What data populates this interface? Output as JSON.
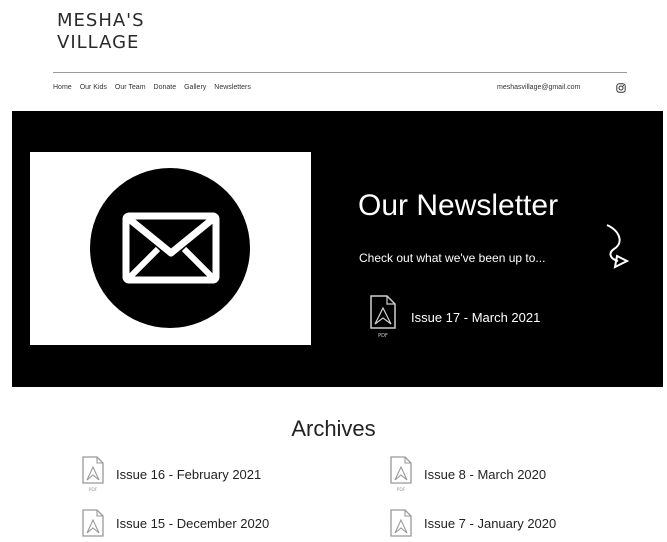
{
  "logo": {
    "line1": "MESHA'S",
    "line2": "VILLAGE"
  },
  "nav": {
    "items": [
      "Home",
      "Our Kids",
      "Our Team",
      "Donate",
      "Gallery",
      "Newsletters"
    ]
  },
  "header": {
    "email": "meshasvillage@gmail.com",
    "social_icon": "instagram-icon"
  },
  "hero": {
    "title": "Our Newsletter",
    "subtitle": "Check out what we've been up to...",
    "latest_issue": "Issue 17 - March 2021",
    "file_label": "PDF"
  },
  "archives": {
    "heading": "Archives",
    "items": [
      "Issue 16 - February 2021",
      "Issue 8 - March 2020",
      "Issue 15 - December 2020",
      "Issue 7 - January 2020"
    ],
    "file_label": "PDF"
  },
  "colors": {
    "hero_bg": "#000000",
    "text": "#222222",
    "divider": "#9a9a9a"
  }
}
